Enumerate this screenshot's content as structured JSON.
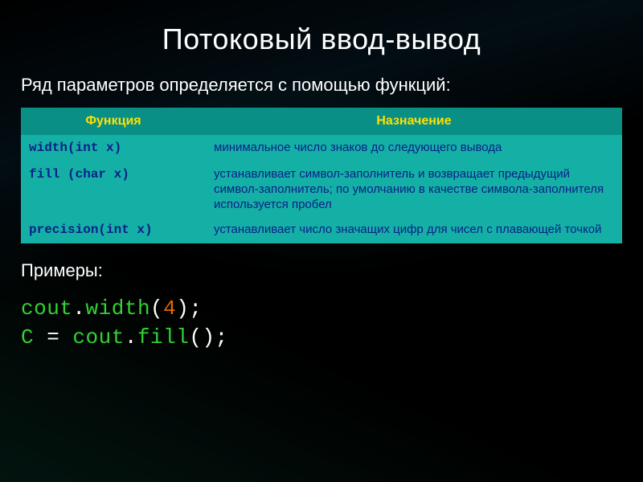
{
  "title": "Потоковый ввод-вывод",
  "intro": "Ряд параметров определяется с помощью функций:",
  "table": {
    "headers": {
      "col1": "Функция",
      "col2": "Назначение"
    },
    "rows": [
      {
        "fn": "width(int x)",
        "desc": "минимальное число знаков до следующего вывода"
      },
      {
        "fn": "fill (char x)",
        "desc": "устанавливает символ-заполнитель и возвращает предыдущий символ-заполнитель; по умолчанию в качестве символа-заполнителя используется пробел"
      },
      {
        "fn": "precision(int x)",
        "desc": "устанавливает число значащих цифр для чисел с плавающей точкой"
      }
    ]
  },
  "examples_label": "Примеры:",
  "code": {
    "line1": {
      "a": "cout",
      "b": ".",
      "c": "width",
      "d": "(",
      "e": "4",
      "f": ");"
    },
    "line2": {
      "a": "C",
      "b": " = ",
      "c": "cout",
      "d": ".",
      "e": "fill",
      "f": "();"
    }
  }
}
